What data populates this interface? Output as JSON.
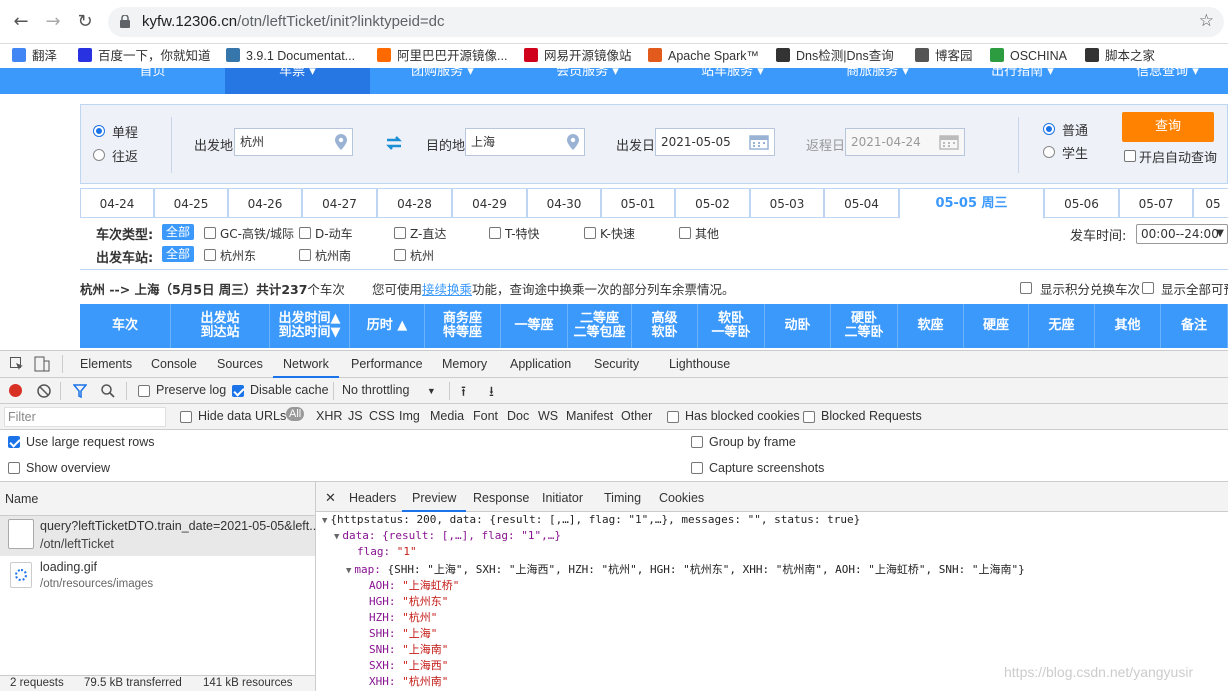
{
  "browser": {
    "url_host": "kyfw.12306.cn",
    "url_path": "/otn/leftTicket/init?linktypeid=dc",
    "bookmarks": [
      {
        "label": "翻泽",
        "icon": "google-translate-icon",
        "color": "#4285f4"
      },
      {
        "label": "百度一下，你就知道",
        "icon": "baidu-icon",
        "color": "#2932e1"
      },
      {
        "label": "3.9.1 Documentat...",
        "icon": "python-icon",
        "color": "#3776ab"
      },
      {
        "label": "阿里巴巴开源镜像...",
        "icon": "aliyun-icon",
        "color": "#ff6a00"
      },
      {
        "label": "网易开源镜像站",
        "icon": "netease-icon",
        "color": "#d0021b"
      },
      {
        "label": "Apache Spark™",
        "icon": "spark-star-icon",
        "color": "#e25a1c"
      },
      {
        "label": "Dns检测|Dns查询",
        "icon": "dns-icon",
        "color": "#333333"
      },
      {
        "label": "博客园",
        "icon": "cnblogs-icon",
        "color": "#555555"
      },
      {
        "label": "OSCHINA",
        "icon": "oschina-icon",
        "color": "#2d9c41"
      },
      {
        "label": "脚本之家",
        "icon": "jb51-icon",
        "color": "#333333"
      }
    ]
  },
  "site_nav": [
    "首页",
    "车票 ▾",
    "团购服务 ▾",
    "会员服务 ▾",
    "站车服务 ▾",
    "商旅服务 ▾",
    "出行指南 ▾",
    "信息查询 ▾"
  ],
  "search": {
    "oneway": "单程",
    "roundtrip": "往返",
    "from_label": "出发地",
    "from_value": "杭州",
    "to_label": "目的地",
    "to_value": "上海",
    "date_label": "出发日",
    "date_value": "2021-05-05",
    "return_label": "返程日",
    "return_value": "2021-04-24",
    "normal": "普通",
    "student": "学生",
    "query_button": "查询",
    "auto_query": "开启自动查询"
  },
  "date_tabs": [
    "04-24",
    "04-25",
    "04-26",
    "04-27",
    "04-28",
    "04-29",
    "04-30",
    "05-01",
    "05-02",
    "05-03",
    "05-04",
    "05-05 周三",
    "05-06",
    "05-07",
    "05"
  ],
  "filters": {
    "type_label": "车次类型:",
    "station_label": "出发车站:",
    "all": "全部",
    "types": [
      "GC-高铁/城际",
      "D-动车",
      "Z-直达",
      "T-特快",
      "K-快速",
      "其他"
    ],
    "stations": [
      "杭州东",
      "杭州南",
      "杭州"
    ],
    "time_label": "发车时间:",
    "time_value": "00:00--24:00"
  },
  "info": {
    "route": "杭州 --> 上海（5月5日  周三）共计",
    "count": "237",
    "count_suffix": "个车次",
    "hint_pre": "您可使用",
    "hint_link": "接续换乘",
    "hint_post": "功能，查询途中换乘一次的部分列车余票情况。",
    "points_option": "显示积分兑换车次",
    "all_option": "显示全部可预"
  },
  "table_headers": [
    "车次",
    "出发站\n到达站",
    "出发时间▲\n到达时间▼",
    "历时 ▲",
    "商务座\n特等座",
    "一等座",
    "二等座\n二等包座",
    "高级\n软卧",
    "软卧\n一等卧",
    "动卧",
    "硬卧\n二等卧",
    "软座",
    "硬座",
    "无座",
    "其他",
    "备注"
  ],
  "devtools": {
    "tabs": [
      "Elements",
      "Console",
      "Sources",
      "Network",
      "Performance",
      "Memory",
      "Application",
      "Security",
      "Lighthouse"
    ],
    "preserve_log": "Preserve log",
    "disable_cache": "Disable cache",
    "throttling": "No throttling",
    "filter_placeholder": "Filter",
    "hide_data_urls": "Hide data URLs",
    "types": [
      "All",
      "XHR",
      "JS",
      "CSS",
      "Img",
      "Media",
      "Font",
      "Doc",
      "WS",
      "Manifest",
      "Other"
    ],
    "blocked_cookies": "Has blocked cookies",
    "blocked_requests": "Blocked Requests",
    "large_rows": "Use large request rows",
    "show_overview": "Show overview",
    "group_by_frame": "Group by frame",
    "capture_screenshots": "Capture screenshots",
    "name_header": "Name",
    "requests": [
      {
        "name": "query?leftTicketDTO.train_date=2021-05-05&left...",
        "path": "/otn/leftTicket"
      },
      {
        "name": "loading.gif",
        "path": "/otn/resources/images"
      }
    ],
    "summary": [
      "2 requests",
      "79.5 kB transferred",
      "141 kB resources"
    ],
    "detail_tabs": [
      "Headers",
      "Preview",
      "Response",
      "Initiator",
      "Timing",
      "Cookies"
    ],
    "preview": {
      "line1": "{httpstatus: 200, data: {result: [,…], flag: \"1\",…}, messages: \"\", status: true}",
      "line2": "data: {result: [,…], flag: \"1\",…}",
      "flag_key": "flag: ",
      "flag_val": "\"1\"",
      "map_key": "map: ",
      "map_summary": "{SHH: \"上海\", SXH: \"上海西\", HZH: \"杭州\", HGH: \"杭州东\", XHH: \"杭州南\", AOH: \"上海虹桥\", SNH: \"上海南\"}",
      "entries": [
        {
          "k": "AOH: ",
          "v": "\"上海虹桥\""
        },
        {
          "k": "HGH: ",
          "v": "\"杭州东\""
        },
        {
          "k": "HZH: ",
          "v": "\"杭州\""
        },
        {
          "k": "SHH: ",
          "v": "\"上海\""
        },
        {
          "k": "SNH: ",
          "v": "\"上海南\""
        },
        {
          "k": "SXH: ",
          "v": "\"上海西\""
        },
        {
          "k": "XHH: ",
          "v": "\"杭州南\""
        }
      ]
    },
    "watermark": "https://blog.csdn.net/yangyusir"
  }
}
